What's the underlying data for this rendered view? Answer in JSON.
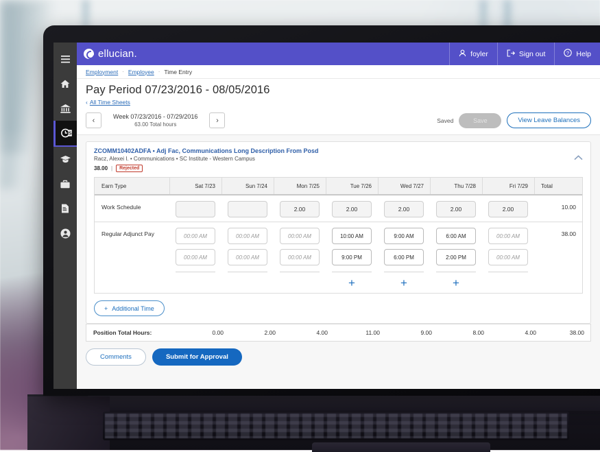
{
  "topbar": {
    "logo_text": "ellucian.",
    "user_label": "foyler",
    "signout_label": "Sign out",
    "help_label": "Help",
    "bg_color": "#5450c8"
  },
  "sidebar": {
    "items": [
      {
        "name": "menu-icon",
        "label": "Menu"
      },
      {
        "name": "home-icon",
        "label": "Home"
      },
      {
        "name": "bank-icon",
        "label": "Finance"
      },
      {
        "name": "time-entry-icon",
        "label": "Time Entry",
        "active": true
      },
      {
        "name": "graduation-icon",
        "label": "Student"
      },
      {
        "name": "briefcase-icon",
        "label": "Employment"
      },
      {
        "name": "document-icon",
        "label": "Documents"
      },
      {
        "name": "person-icon",
        "label": "Profile"
      }
    ]
  },
  "breadcrumb": {
    "items": [
      {
        "label": "Employment",
        "link": true
      },
      {
        "label": "Employee",
        "link": true
      },
      {
        "label": "Time Entry",
        "link": false
      }
    ],
    "separator": "·"
  },
  "page": {
    "title": "Pay Period 07/23/2016 - 08/05/2016",
    "back_label": "All Time Sheets",
    "back_chevron": "‹"
  },
  "weekbar": {
    "prev_icon": "‹",
    "next_icon": "›",
    "week_range": "Week 07/23/2016 - 07/29/2016",
    "week_total": "63.00 Total hours",
    "saved_label": "Saved",
    "save_label": "Save",
    "leave_balances_label": "View Leave Balances"
  },
  "job": {
    "position_title": "ZCOMM10402ADFA • Adj Fac, Communications Long Description From Posd",
    "employee_line": "Racz, Alexei I. • Communications • SC Institute - Western Campus",
    "hours": "38.00",
    "separator": "|",
    "status_badge": "Rejected",
    "collapse_icon": "chevron-up-icon"
  },
  "grid": {
    "columns": [
      "Earn Type",
      "Sat 7/23",
      "Sun 7/24",
      "Mon 7/25",
      "Tue 7/26",
      "Wed 7/27",
      "Thu 7/28",
      "Fri 7/29",
      "Total"
    ],
    "work_schedule": {
      "label": "Work Schedule",
      "values": [
        "",
        "",
        "2.00",
        "2.00",
        "2.00",
        "2.00",
        "2.00"
      ],
      "total": "10.00"
    },
    "regular_adjunct_pay": {
      "label": "Regular Adjunct Pay",
      "start_times": [
        "00:00 AM",
        "00:00 AM",
        "00:00 AM",
        "10:00 AM",
        "9:00 AM",
        "6:00 AM",
        "00:00 AM"
      ],
      "start_placeholder_flags": [
        true,
        true,
        true,
        false,
        false,
        false,
        true
      ],
      "end_times": [
        "00:00 AM",
        "00:00 AM",
        "00:00 AM",
        "9:00 PM",
        "6:00 PM",
        "2:00 PM",
        "00:00 AM"
      ],
      "end_placeholder_flags": [
        true,
        true,
        true,
        false,
        false,
        false,
        true
      ],
      "add_buttons": [
        false,
        false,
        false,
        true,
        true,
        true,
        false
      ],
      "add_icon": "+",
      "total": "38.00"
    }
  },
  "additional_time": {
    "icon": "+",
    "label": "Additional Time"
  },
  "position_totals": {
    "label": "Position Total Hours:",
    "values": [
      "0.00",
      "2.00",
      "4.00",
      "11.00",
      "9.00",
      "8.00",
      "4.00"
    ],
    "total": "38.00"
  },
  "actions": {
    "comments_label": "Comments",
    "submit_label": "Submit for Approval",
    "submit_color": "#1568c0"
  }
}
